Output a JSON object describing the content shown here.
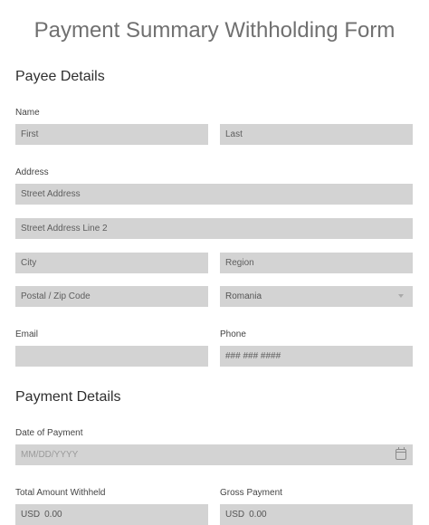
{
  "form": {
    "title": "Payment Summary Withholding Form"
  },
  "payee": {
    "heading": "Payee Details",
    "name_label": "Name",
    "first_placeholder": "First",
    "last_placeholder": "Last",
    "address_label": "Address",
    "street_placeholder": "Street Address",
    "street2_placeholder": "Street Address Line 2",
    "city_placeholder": "City",
    "region_placeholder": "Region",
    "postal_placeholder": "Postal / Zip Code",
    "country_value": "Romania",
    "email_label": "Email",
    "phone_label": "Phone",
    "phone_placeholder": "### ### ####"
  },
  "payment": {
    "heading": "Payment Details",
    "date_label": "Date of Payment",
    "date_placeholder": "MM/DD/YYYY",
    "total_label": "Total Amount Withheld",
    "gross_label": "Gross Payment",
    "currency": "USD",
    "total_value": "0.00",
    "gross_value": "0.00"
  },
  "icons": {
    "calendar": "calendar-icon",
    "dropdown": "chevron-down-icon"
  }
}
